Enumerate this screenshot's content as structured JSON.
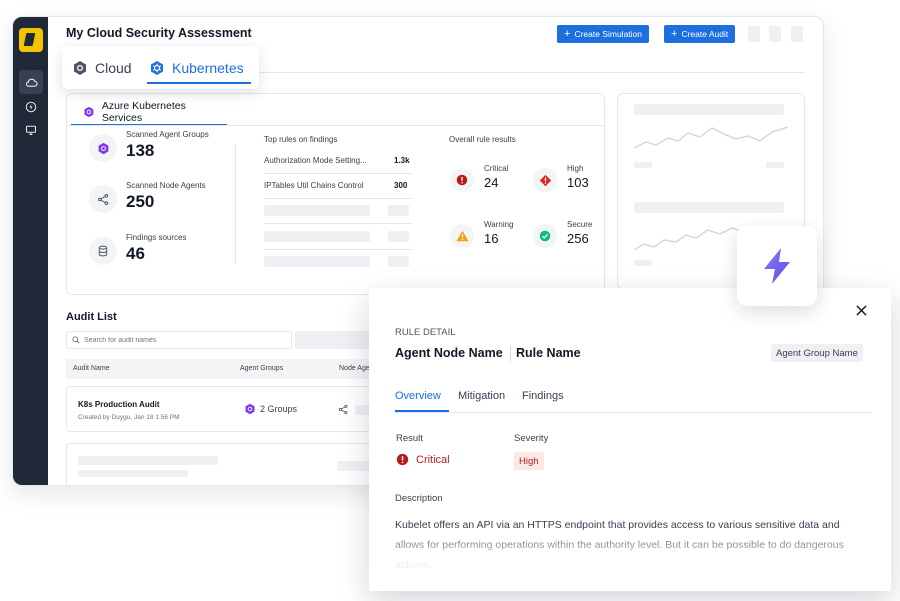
{
  "header": {
    "title": "My Cloud Security Assessment",
    "create_simulation": "Create Simulation",
    "create_audit": "Create Audit"
  },
  "platform_tabs": [
    {
      "label": "Cloud",
      "active": false
    },
    {
      "label": "Kubernetes",
      "active": true
    }
  ],
  "service_tab": "Azure Kubernetes Services",
  "stats": [
    {
      "label": "Scanned Agent Groups",
      "value": "138",
      "icon": "kubernetes-icon"
    },
    {
      "label": "Scanned Node Agents",
      "value": "250",
      "icon": "node-agents-icon"
    },
    {
      "label": "Findings sources",
      "value": "46",
      "icon": "database-icon"
    }
  ],
  "top_rules": {
    "title": "Top rules on findings",
    "rules": [
      {
        "name": "Authorization Mode Setting...",
        "count": "1.3k"
      },
      {
        "name": "IPTables Util Chains Control",
        "count": "300"
      }
    ]
  },
  "overall": {
    "title": "Overall rule results",
    "items": [
      {
        "label": "Critical",
        "value": "24",
        "color": "#b91c1c",
        "icon": "critical-icon"
      },
      {
        "label": "High",
        "value": "103",
        "color": "#dc2626",
        "icon": "high-icon"
      },
      {
        "label": "Warning",
        "value": "16",
        "color": "#f59e0b",
        "icon": "warning-icon"
      },
      {
        "label": "Secure",
        "value": "256",
        "color": "#10b981",
        "icon": "check-icon"
      }
    ]
  },
  "audit_list": {
    "title": "Audit List",
    "search_placeholder": "Search for audit names",
    "columns": [
      "Audit Name",
      "Agent Groups",
      "Node Age"
    ],
    "rows": [
      {
        "name": "K8s Production Audit",
        "meta": "Created by Duygu, Jan 18 1:56 PM",
        "groups": "2 Groups"
      }
    ]
  },
  "modal": {
    "kicker": "RULE DETAIL",
    "title_left": "Agent Node Name",
    "title_right": "Rule Name",
    "pill": "Agent Group Name",
    "tabs": [
      "Overview",
      "Mitigation",
      "Findings"
    ],
    "result_label": "Result",
    "result_value": "Critical",
    "severity_label": "Severity",
    "severity_value": "High",
    "description_label": "Description",
    "description": "Kubelet offers an API via an HTTPS endpoint that provides access to various sensitive data and allows for performing operations within the authority level. But it can be possible to do dangerous actions."
  },
  "colors": {
    "accent": "#1d6fe0",
    "sidebar": "#1f2937",
    "logo": "#f5c400",
    "critical": "#b91c1c",
    "kubernetes": "#7c3aed",
    "flash": "#6d5df0"
  }
}
